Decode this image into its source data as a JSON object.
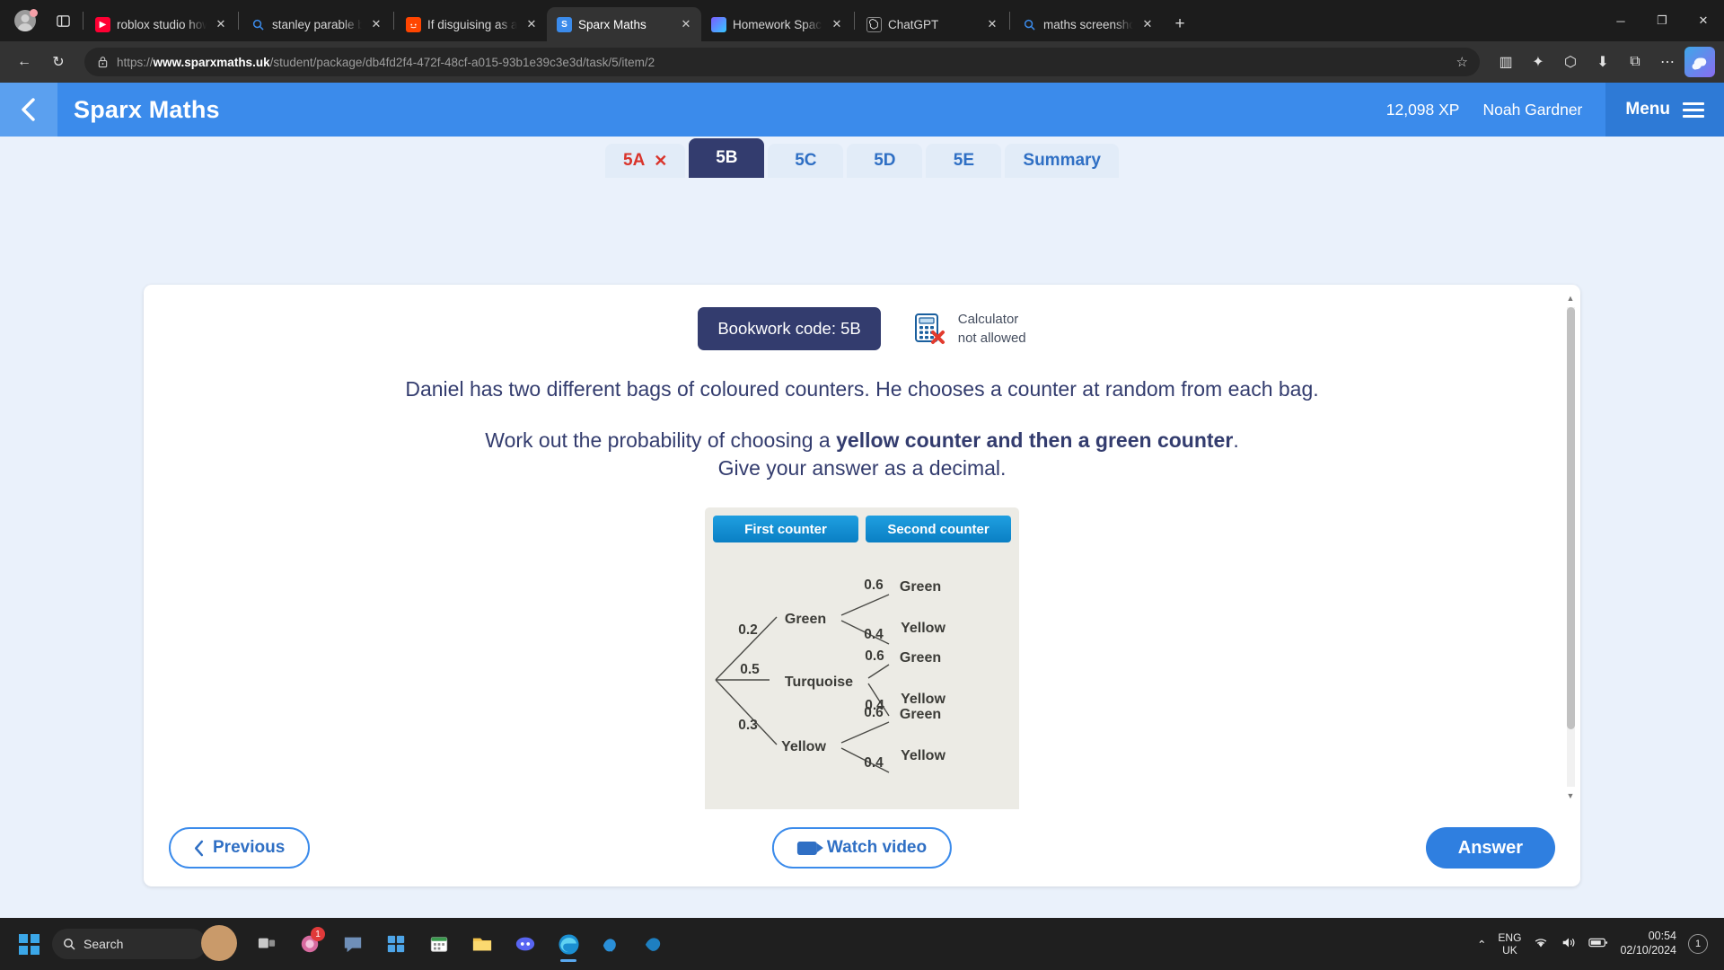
{
  "browser": {
    "tabs": [
      {
        "title": "roblox studio how to",
        "favicon": "youtube-icon",
        "glyph": "▶",
        "active": false
      },
      {
        "title": "stanley parable break",
        "favicon": "search-icon",
        "glyph": "⚲",
        "active": false
      },
      {
        "title": "If disguising as a frien",
        "favicon": "reddit-icon",
        "glyph": "◉",
        "active": false
      },
      {
        "title": "Sparx Maths",
        "favicon": "sparx-icon",
        "glyph": "S",
        "active": true
      },
      {
        "title": "Homework Space - St",
        "favicon": "homework-icon",
        "glyph": "",
        "active": false
      },
      {
        "title": "ChatGPT",
        "favicon": "chatgpt-icon",
        "glyph": "⍟",
        "active": false
      },
      {
        "title": "maths screenshot sol",
        "favicon": "search-icon",
        "glyph": "⚲",
        "active": false
      }
    ],
    "new_tab_label": "+",
    "close_label": "✕",
    "window_controls": {
      "minimize": "─",
      "maximize": "❐",
      "close": "✕"
    },
    "toolbar": {
      "back": "←",
      "refresh": "↻",
      "url_scheme": "https://",
      "url_domain": "www.sparxmaths.uk",
      "url_path": "/student/package/db4fd2f4-472f-48cf-a015-93b1e39c3e3d/task/5/item/2",
      "full_url": "https://www.sparxmaths.uk/student/package/db4fd2f4-472f-48cf-a015-93b1e39c3e3d/task/5/item/2",
      "favourite": "☆",
      "split_screen": "▥",
      "collections": "✦",
      "browser_essentials": "⬡",
      "downloads": "⬇",
      "extensions": "⧉",
      "settings_more": "⋯",
      "copilot": "◑"
    }
  },
  "sparx": {
    "header": {
      "back_icon": "chevron-left-icon",
      "logo": "Sparx Maths",
      "xp": "12,098 XP",
      "username": "Noah Gardner",
      "menu_label": "Menu"
    },
    "question_tabs": [
      {
        "label": "5A",
        "state": "completed",
        "mark": "✕"
      },
      {
        "label": "5B",
        "state": "active",
        "mark": ""
      },
      {
        "label": "5C",
        "state": "default",
        "mark": ""
      },
      {
        "label": "5D",
        "state": "default",
        "mark": ""
      },
      {
        "label": "5E",
        "state": "default",
        "mark": ""
      },
      {
        "label": "Summary",
        "state": "default",
        "mark": ""
      }
    ],
    "bookwork_code": "Bookwork code: 5B",
    "calculator": {
      "line1": "Calculator",
      "line2": "not allowed",
      "icon": "calculator-not-allowed-icon"
    },
    "question": {
      "line1": "Daniel has two different bags of coloured counters. He chooses a counter at random from each bag.",
      "line2_prefix": "Work out the probability of choosing a ",
      "line2_bold": "yellow counter and then a green counter",
      "line2_suffix": ".",
      "line3": "Give your answer as a decimal."
    },
    "footer": {
      "previous": "Previous",
      "previous_icon": "chevron-left-icon",
      "watch_video": "Watch video",
      "video_icon": "video-camera-icon",
      "answer": "Answer"
    },
    "scrollbar": {
      "up": "▲",
      "down": "▼"
    }
  },
  "chart_data": {
    "type": "diagram",
    "diagram_kind": "probability-tree",
    "title": "",
    "column_headers": [
      "First counter",
      "Second counter"
    ],
    "branches": [
      {
        "label": "Green",
        "probability": "0.2",
        "children": [
          {
            "label": "Green",
            "probability": "0.6"
          },
          {
            "label": "Yellow",
            "probability": "0.4"
          }
        ]
      },
      {
        "label": "Turquoise",
        "probability": "0.5",
        "children": [
          {
            "label": "Green",
            "probability": "0.6"
          },
          {
            "label": "Yellow",
            "probability": "0.4"
          }
        ]
      },
      {
        "label": "Yellow",
        "probability": "0.3",
        "children": [
          {
            "label": "Green",
            "probability": "0.6"
          },
          {
            "label": "Yellow",
            "probability": "0.4"
          }
        ]
      }
    ],
    "background": "#ecebe5",
    "header_color": "#0f8fd4"
  },
  "taskbar": {
    "start_icon": "windows-logo-icon",
    "search_placeholder": "Search",
    "search_icon": "search-icon",
    "icons": [
      {
        "name": "task-view-icon",
        "glyph": "▭",
        "badge": ""
      },
      {
        "name": "notification-app-icon",
        "glyph": "◔",
        "badge": "1"
      },
      {
        "name": "chat-icon",
        "glyph": "●",
        "badge": ""
      },
      {
        "name": "microsoft-store-icon",
        "glyph": "⊞",
        "badge": ""
      },
      {
        "name": "calendar-icon",
        "glyph": "☷",
        "badge": ""
      },
      {
        "name": "file-explorer-icon",
        "glyph": "▰",
        "badge": ""
      },
      {
        "name": "discord-icon",
        "glyph": "◕",
        "badge": ""
      },
      {
        "name": "edge-icon",
        "glyph": "◎",
        "badge": ""
      },
      {
        "name": "steam-icon",
        "glyph": "❦",
        "badge": ""
      },
      {
        "name": "steam-alt-icon",
        "glyph": "❦",
        "badge": ""
      }
    ],
    "tray": {
      "overflow": "⌃",
      "language_line1": "ENG",
      "language_line2": "UK",
      "wifi_icon": "◠",
      "volume_icon": "◂",
      "battery_icon": "▭",
      "time": "00:54",
      "date": "02/10/2024",
      "notification_count": "1"
    }
  }
}
